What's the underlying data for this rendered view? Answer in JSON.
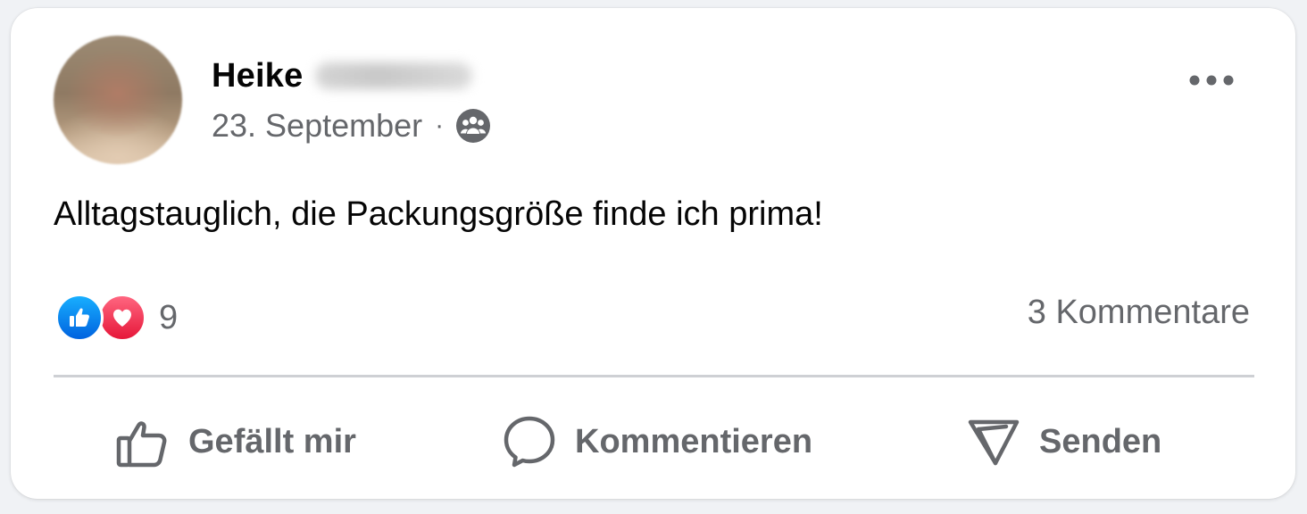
{
  "post": {
    "author_first_name": "Heike",
    "date": "23. September",
    "separator": "·",
    "audience_icon": "friends-icon",
    "text": "Alltagstauglich, die Packungsgröße finde ich prima!",
    "more_icon": "more-options-icon"
  },
  "engagement": {
    "reaction_icons": [
      "like-reaction-icon",
      "love-reaction-icon"
    ],
    "reaction_count": "9",
    "comments_count": "3 Kommentare"
  },
  "actions": {
    "like_label": "Gefällt mir",
    "comment_label": "Kommentieren",
    "send_label": "Senden"
  },
  "colors": {
    "like_blue": "#0866ff",
    "love_red": "#f33e58",
    "secondary_text": "#65676b",
    "primary_text": "#050505",
    "divider": "#ced0d4"
  }
}
